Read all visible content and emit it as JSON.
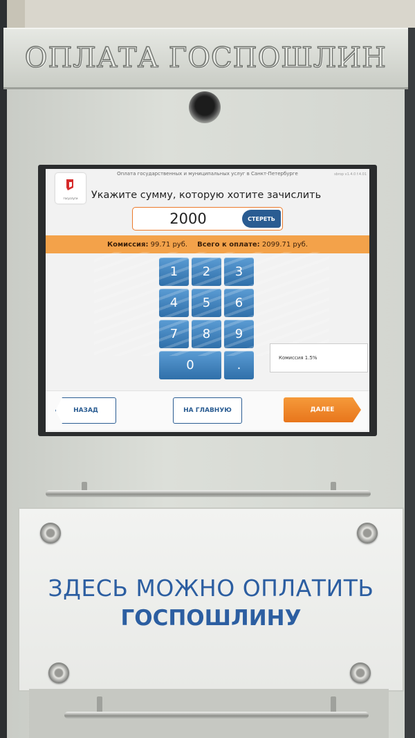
{
  "kiosk": {
    "header_text": "ОПЛАТА ГОСПОШЛИН",
    "panel_line1": "ЗДЕСЬ МОЖНО ОПЛАТИТЬ",
    "panel_line2": "ГОСПОШЛИНУ"
  },
  "screen": {
    "caption": "Оплата государственных и муниципальных услуг в Санкт-Петербурге",
    "version": "sbrop v1.4.0 f.4.01",
    "logo_sub": "госуслуги",
    "prompt": "Укажите сумму, которую хотите зачислить",
    "amount": "2000",
    "clear_label": "СТЕРЕТЬ",
    "fee_label": "Комиссия:",
    "fee_value": "99.71 руб.",
    "total_label": "Всего к оплате:",
    "total_value": "2099.71 руб.",
    "keys": [
      "1",
      "2",
      "3",
      "4",
      "5",
      "6",
      "7",
      "8",
      "9",
      "0",
      "."
    ],
    "commission_tip": "Комиссия 1.5%",
    "back_label": "НАЗАД",
    "home_label": "НА ГЛАВНУЮ",
    "next_label": "ДАЛЕЕ"
  },
  "colors": {
    "accent_orange": "#f3a24a",
    "button_blue": "#2a5c92",
    "key_blue": "#3f83c2",
    "panel_text_blue": "#2c5ea1"
  }
}
